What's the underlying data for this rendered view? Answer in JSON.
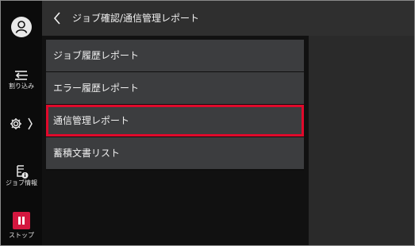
{
  "rail": {
    "interrupt_label": "割り込み",
    "job_info_label": "ジョブ情報",
    "stop_label": "ストップ"
  },
  "header": {
    "title": "ジョブ確認/通信管理レポート"
  },
  "menu": {
    "items": [
      {
        "label": "ジョブ履歴レポート",
        "selected": false
      },
      {
        "label": "エラー履歴レポート",
        "selected": false
      },
      {
        "label": "通信管理レポート",
        "selected": true
      },
      {
        "label": "蓄積文書リスト",
        "selected": false
      }
    ]
  },
  "colors": {
    "highlight": "#e0092b",
    "stop": "#d4173f",
    "item_bg": "#3c3d3f",
    "header_bg": "#2f2f2f"
  },
  "icons": {
    "user": "user-icon",
    "interrupt": "interrupt-icon",
    "settings": "gear-icon",
    "job_info": "job-info-icon",
    "stop": "stop-icon",
    "back": "chevron-left-icon"
  }
}
